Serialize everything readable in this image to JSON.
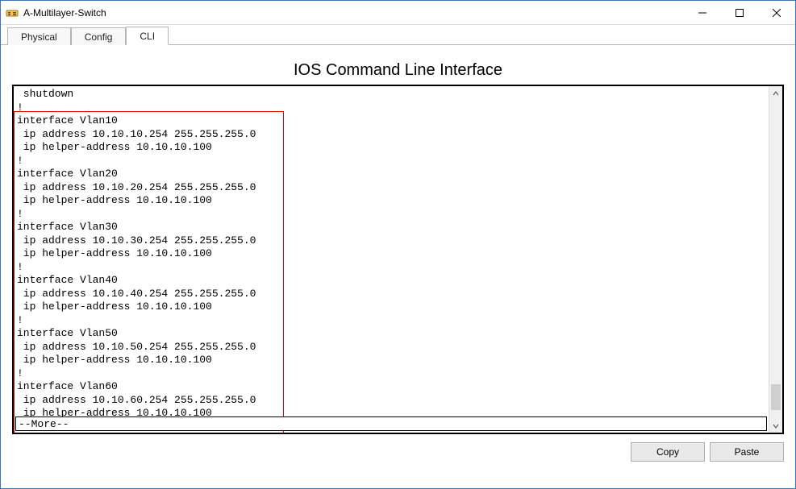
{
  "window": {
    "title": "A-Multilayer-Switch"
  },
  "tabs": {
    "physical": "Physical",
    "config": "Config",
    "cli": "CLI"
  },
  "heading": "IOS Command Line Interface",
  "terminal": {
    "line01": " shutdown",
    "line02": "!",
    "line03": "interface Vlan10",
    "line04": " ip address 10.10.10.254 255.255.255.0",
    "line05": " ip helper-address 10.10.10.100",
    "line06": "!",
    "line07": "interface Vlan20",
    "line08": " ip address 10.10.20.254 255.255.255.0",
    "line09": " ip helper-address 10.10.10.100",
    "line10": "!",
    "line11": "interface Vlan30",
    "line12": " ip address 10.10.30.254 255.255.255.0",
    "line13": " ip helper-address 10.10.10.100",
    "line14": "!",
    "line15": "interface Vlan40",
    "line16": " ip address 10.10.40.254 255.255.255.0",
    "line17": " ip helper-address 10.10.10.100",
    "line18": "!",
    "line19": "interface Vlan50",
    "line20": " ip address 10.10.50.254 255.255.255.0",
    "line21": " ip helper-address 10.10.10.100",
    "line22": "!",
    "line23": "interface Vlan60",
    "line24": " ip address 10.10.60.254 255.255.255.0",
    "line25": " ip helper-address 10.10.10.100",
    "line26": "!"
  },
  "inputline": " --More--",
  "buttons": {
    "copy": "Copy",
    "paste": "Paste"
  }
}
